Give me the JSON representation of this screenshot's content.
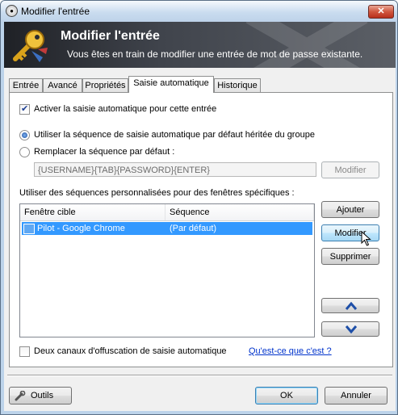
{
  "window": {
    "title": "Modifier l'entrée",
    "close_glyph": "✕"
  },
  "banner": {
    "title": "Modifier l'entrée",
    "subtitle": "Vous êtes en train de modifier une entrée de mot de passe existante."
  },
  "tabs": [
    {
      "label": "Entrée",
      "active": false
    },
    {
      "label": "Avancé",
      "active": false
    },
    {
      "label": "Propriétés",
      "active": false
    },
    {
      "label": "Saisie automatique",
      "active": true
    },
    {
      "label": "Historique",
      "active": false
    }
  ],
  "autotype": {
    "enable_label": "Activer la saisie automatique pour cette entrée",
    "enable_checked": true,
    "inherit_label": "Utiliser la séquence de saisie automatique par défaut héritée du groupe",
    "override_label": "Remplacer la séquence par défaut :",
    "selected_option": "inherit",
    "sequence_value": "{USERNAME}{TAB}{PASSWORD}{ENTER}",
    "sequence_modify_button": "Modifier",
    "custom_label": "Utiliser des séquences personnalisées pour des fenêtres spécifiques :",
    "columns": [
      "Fenêtre cible",
      "Séquence"
    ],
    "rows": [
      {
        "target": "Pilot - Google Chrome",
        "sequence": "(Par défaut)",
        "selected": true
      }
    ],
    "add_button": "Ajouter",
    "edit_button": "Modifier",
    "delete_button": "Supprimer",
    "obfuscation_label": "Deux canaux d'offuscation de saisie automatique",
    "obfuscation_checked": false,
    "help_link": "Qu'est-ce que c'est ?"
  },
  "footer": {
    "tools_button": "Outils",
    "ok_button": "OK",
    "cancel_button": "Annuler"
  },
  "colors": {
    "selection": "#3399ff",
    "link": "#0033cc",
    "arrow": "#1e4fa8"
  },
  "icons": {
    "title_icon": "lock-icon",
    "banner_icon": "key-icon",
    "row_icon": "window-icon",
    "tools_icon": "tools-icon",
    "up": "arrow-up-icon",
    "down": "arrow-down-icon"
  }
}
